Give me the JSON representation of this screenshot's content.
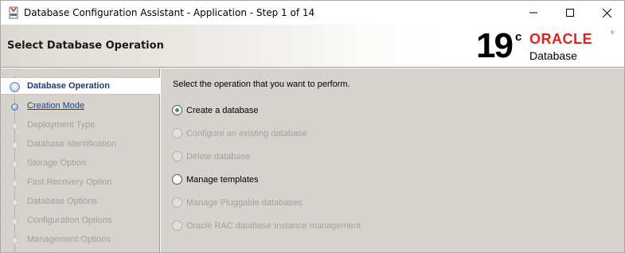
{
  "window": {
    "title": "Database Configuration Assistant - Application - Step 1 of 14",
    "controls": [
      "minimize-icon",
      "maximize-icon",
      "close-icon"
    ]
  },
  "header": {
    "title": "Select Database Operation",
    "logo": {
      "version": "19",
      "version_suffix": "c",
      "brand": "ORACLE",
      "registered": "®",
      "product": "Database",
      "brand_color": "#e2231a"
    }
  },
  "nav": {
    "items": [
      {
        "label": "Database Operation",
        "state": "current"
      },
      {
        "label": "Creation Mode",
        "state": "link"
      },
      {
        "label": "Deployment Type",
        "state": "disabled"
      },
      {
        "label": "Database Identification",
        "state": "disabled"
      },
      {
        "label": "Storage Option",
        "state": "disabled"
      },
      {
        "label": "Fast Recovery Option",
        "state": "disabled"
      },
      {
        "label": "Database Options",
        "state": "disabled"
      },
      {
        "label": "Configuration Options",
        "state": "disabled"
      },
      {
        "label": "Management Options",
        "state": "disabled"
      }
    ]
  },
  "main": {
    "instruction": "Select the operation that you want to perform.",
    "options": [
      {
        "label": "Create a database",
        "checked": true,
        "enabled": true
      },
      {
        "label": "Configure an existing database",
        "checked": false,
        "enabled": false
      },
      {
        "label": "Delete database",
        "checked": false,
        "enabled": false
      },
      {
        "label": "Manage templates",
        "checked": false,
        "enabled": true
      },
      {
        "label": "Manage Pluggable databases",
        "checked": false,
        "enabled": false
      },
      {
        "label": "Oracle RAC database Instance management",
        "checked": false,
        "enabled": false
      }
    ],
    "selected_color": "#3f9a3a"
  }
}
